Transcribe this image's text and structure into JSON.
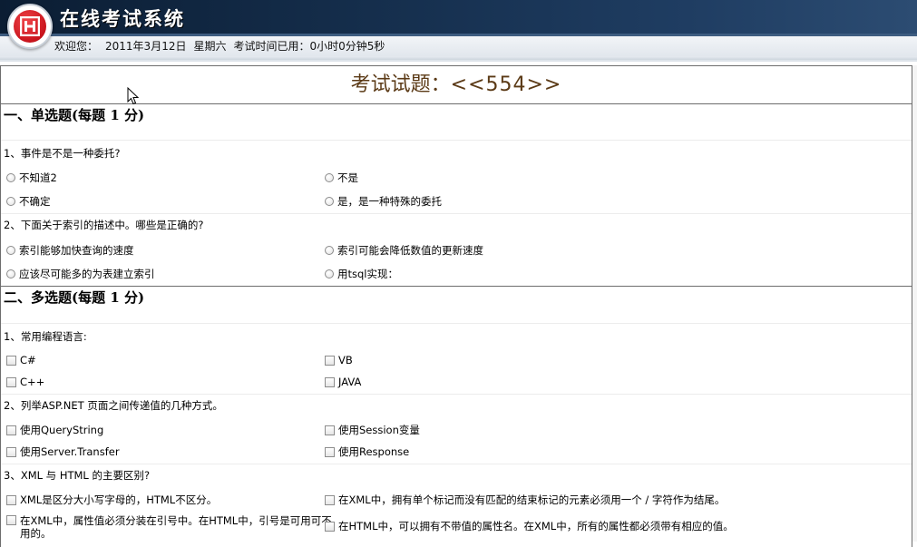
{
  "header": {
    "title": "在线考试系统",
    "welcome": "欢迎您：",
    "date": "2011年3月12日",
    "weekday": "星期六",
    "elapsed_label": "考试时间已用：",
    "elapsed_value": "0小时0分钟5秒"
  },
  "exam": {
    "title_prefix": "考试试题：",
    "title_code": "<<554>>"
  },
  "single_choice": {
    "heading": "一、单选题(每题  1 分)",
    "questions": [
      {
        "text": "1、事件是不是一种委托?",
        "options": [
          "不知道2",
          "不是",
          "不确定",
          "是，是一种特殊的委托"
        ]
      },
      {
        "text": "2、下面关于索引的描述中。哪些是正确的?",
        "options": [
          "索引能够加快查询的速度",
          "索引可能会降低数值的更新速度",
          "应该尽可能多的为表建立索引",
          "用tsql实现："
        ]
      }
    ]
  },
  "multi_choice": {
    "heading": "二、多选题(每题  1 分)",
    "questions": [
      {
        "text": "1、常用编程语言:",
        "options": [
          "C#",
          "VB",
          "C++",
          "JAVA"
        ]
      },
      {
        "text": "2、列举ASP.NET 页面之间传递值的几种方式。",
        "options": [
          "使用QueryString",
          "使用Session变量",
          "使用Server.Transfer",
          "使用Response"
        ]
      },
      {
        "text": "3、XML 与 HTML 的主要区别?",
        "options": [
          "XML是区分大小写字母的，HTML不区分。",
          "在XML中，拥有单个标记而没有匹配的结束标记的元素必须用一个 / 字符作为结尾。",
          "在XML中，属性值必须分装在引号中。在HTML中，引号是可用可不用的。",
          "在HTML中，可以拥有不带值的属性名。在XML中，所有的属性都必须带有相应的值。"
        ]
      }
    ]
  },
  "icons": {
    "logo": "logo-icon",
    "radio": "radio-icon",
    "checkbox": "checkbox-icon",
    "cursor": "mouse-cursor-icon"
  },
  "colors": {
    "header_band": "#16304f",
    "logo_red": "#c9141c",
    "exam_title": "#5b3a16",
    "border": "#6d6d6d"
  }
}
